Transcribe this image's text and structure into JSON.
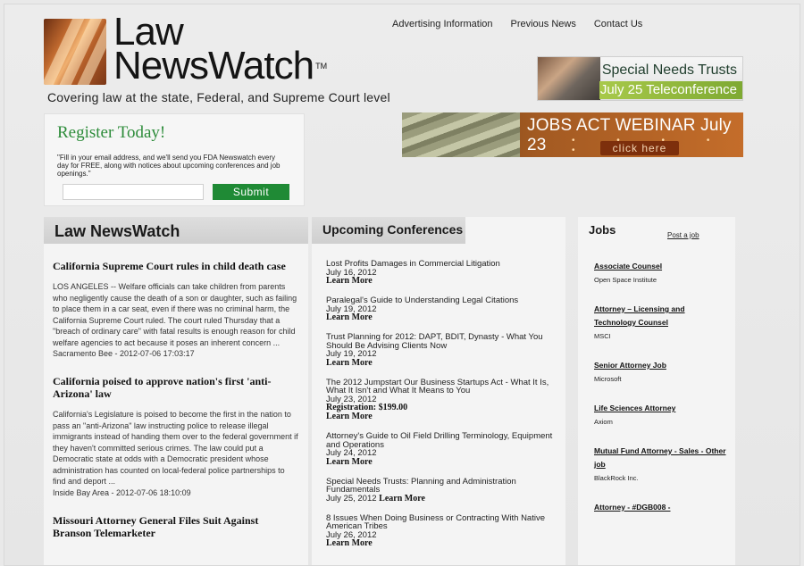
{
  "header": {
    "logo_line1": "Law",
    "logo_line2": "NewsWatch",
    "logo_tm": "TM",
    "tagline": "Covering law at the state, Federal, and Supreme Court level",
    "nav": [
      "Advertising Information",
      "Previous News",
      "Contact Us"
    ]
  },
  "banners": {
    "special_needs": {
      "line1": "Special Needs Trusts",
      "line2": "July 25 Teleconference"
    },
    "jobs_act": {
      "headline": "JOBS ACT WEBINAR July 23",
      "dots": "• • • • •",
      "cta": "click here"
    }
  },
  "register": {
    "title": "Register Today!",
    "text": "\"Fill in your email address, and we'll send you FDA Newswatch every day for FREE, along with notices about upcoming conferences and job openings.\"",
    "email_value": "",
    "submit_label": "Submit"
  },
  "news": {
    "header": "Law NewsWatch",
    "articles": [
      {
        "title": "California Supreme Court rules in child death case",
        "body": "LOS ANGELES -- Welfare officials can take children from parents who negligently cause the death of a son or daughter, such as failing to place them in a car seat, even if there was no criminal harm, the California Supreme Court ruled. The court ruled Thursday that a \"breach of ordinary care\" with fatal results is enough reason for child welfare agencies to act because it poses an inherent concern ...",
        "meta": "Sacramento Bee - 2012-07-06 17:03:17"
      },
      {
        "title": "California poised to approve nation's first 'anti-Arizona' law",
        "body": "California's Legislature is poised to become the first in the nation to pass an \"anti-Arizona\" law instructing police to release illegal immigrants instead of handing them over to the federal government if they haven't committed serious crimes. The law could put a Democratic state at odds with a Democratic president whose administration has counted on local-federal police partnerships to find and deport ...",
        "meta": "Inside Bay Area - 2012-07-06 18:10:09"
      },
      {
        "title": "Missouri Attorney General Files Suit Against Branson Telemarketer",
        "body": "",
        "meta": ""
      }
    ]
  },
  "conferences": {
    "header": "Upcoming Conferences",
    "items": [
      {
        "title": "Lost Profits Damages in Commercial Litigation",
        "date": "July 16, 2012",
        "reg": "",
        "more": "Learn More"
      },
      {
        "title": "Paralegal's Guide to Understanding Legal Citations",
        "date": "July 19, 2012",
        "reg": "",
        "more": "Learn More"
      },
      {
        "title": "Trust Planning for 2012: DAPT, BDIT, Dynasty - What You Should Be Advising Clients Now",
        "date": "July 19, 2012",
        "reg": "",
        "more": "Learn More"
      },
      {
        "title": "The 2012 Jumpstart Our Business Startups Act - What It Is, What It Isn't and What It Means to You",
        "date": "July 23, 2012",
        "reg": "Registration: $199.00",
        "more": "Learn More"
      },
      {
        "title": "Attorney's Guide to Oil Field Drilling Terminology, Equipment and Operations",
        "date": "July 24, 2012",
        "reg": "",
        "more": "Learn More"
      },
      {
        "title": "Special Needs Trusts: Planning and Administration Fundamentals",
        "date": "July 25, 2012",
        "reg": "",
        "more": "Learn More"
      },
      {
        "title": "8 Issues When Doing Business or Contracting With Native American Tribes",
        "date": "July 26, 2012",
        "reg": "",
        "more": "Learn More"
      }
    ]
  },
  "jobs": {
    "header": "Jobs",
    "post_link": "Post a job",
    "items": [
      {
        "title": "Associate Counsel",
        "company": "Open Space Institute"
      },
      {
        "title": "Attorney – Licensing and Technology Counsel",
        "company": "MSCI"
      },
      {
        "title": "Senior Attorney Job",
        "company": "Microsoft"
      },
      {
        "title": "Life Sciences Attorney",
        "company": "Axiom"
      },
      {
        "title": "Mutual Fund Attorney - Sales - Other job",
        "company": "BlackRock Inc."
      },
      {
        "title": "Attorney - #DGB008 -",
        "company": ""
      }
    ]
  },
  "colors": {
    "register_green": "#2d8c3a",
    "submit_green": "#1f8a35",
    "banner_orange": "#c46d2a",
    "banner_lime": "#a8c94a"
  }
}
